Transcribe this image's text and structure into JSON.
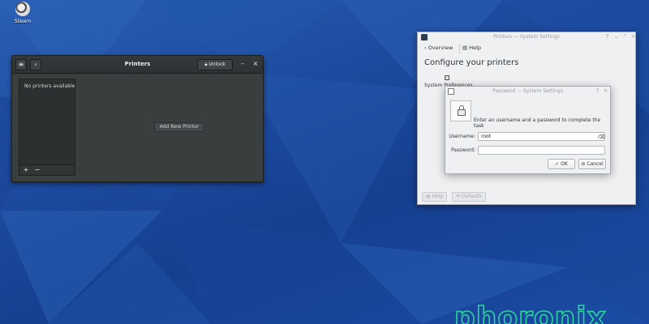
{
  "desktop": {
    "icon_label": "Steam",
    "watermark": "phoronix"
  },
  "printers_window": {
    "title": "Printers",
    "unlock_label": "Unlock",
    "no_printers_text": "No printers available",
    "add_printer_label": "Add New Printer",
    "add_symbol": "+",
    "remove_symbol": "−",
    "back_symbol": "‹",
    "minimize_symbol": "–",
    "close_symbol": "×"
  },
  "system_settings": {
    "title": "Printers — System Settings",
    "toolbar": {
      "overview_label": "Overview",
      "help_label": "Help"
    },
    "heading": "Configure your printers",
    "preferences_label": "System Preferences",
    "footer": {
      "help_label": "Help",
      "defaults_label": "Defaults"
    }
  },
  "password_dialog": {
    "title": "Password — System Settings",
    "message": "Enter an username and a password to complete the task",
    "username_label": "Username:",
    "username_value": "root",
    "password_label": "Password:",
    "password_value": "",
    "ok_label": "OK",
    "cancel_label": "Cancel"
  },
  "colors": {
    "desktop_blue": "#1f4a9c",
    "gnome_dark": "#393f3f",
    "kde_light": "#eff0f1",
    "watermark": "#2bd49a"
  }
}
